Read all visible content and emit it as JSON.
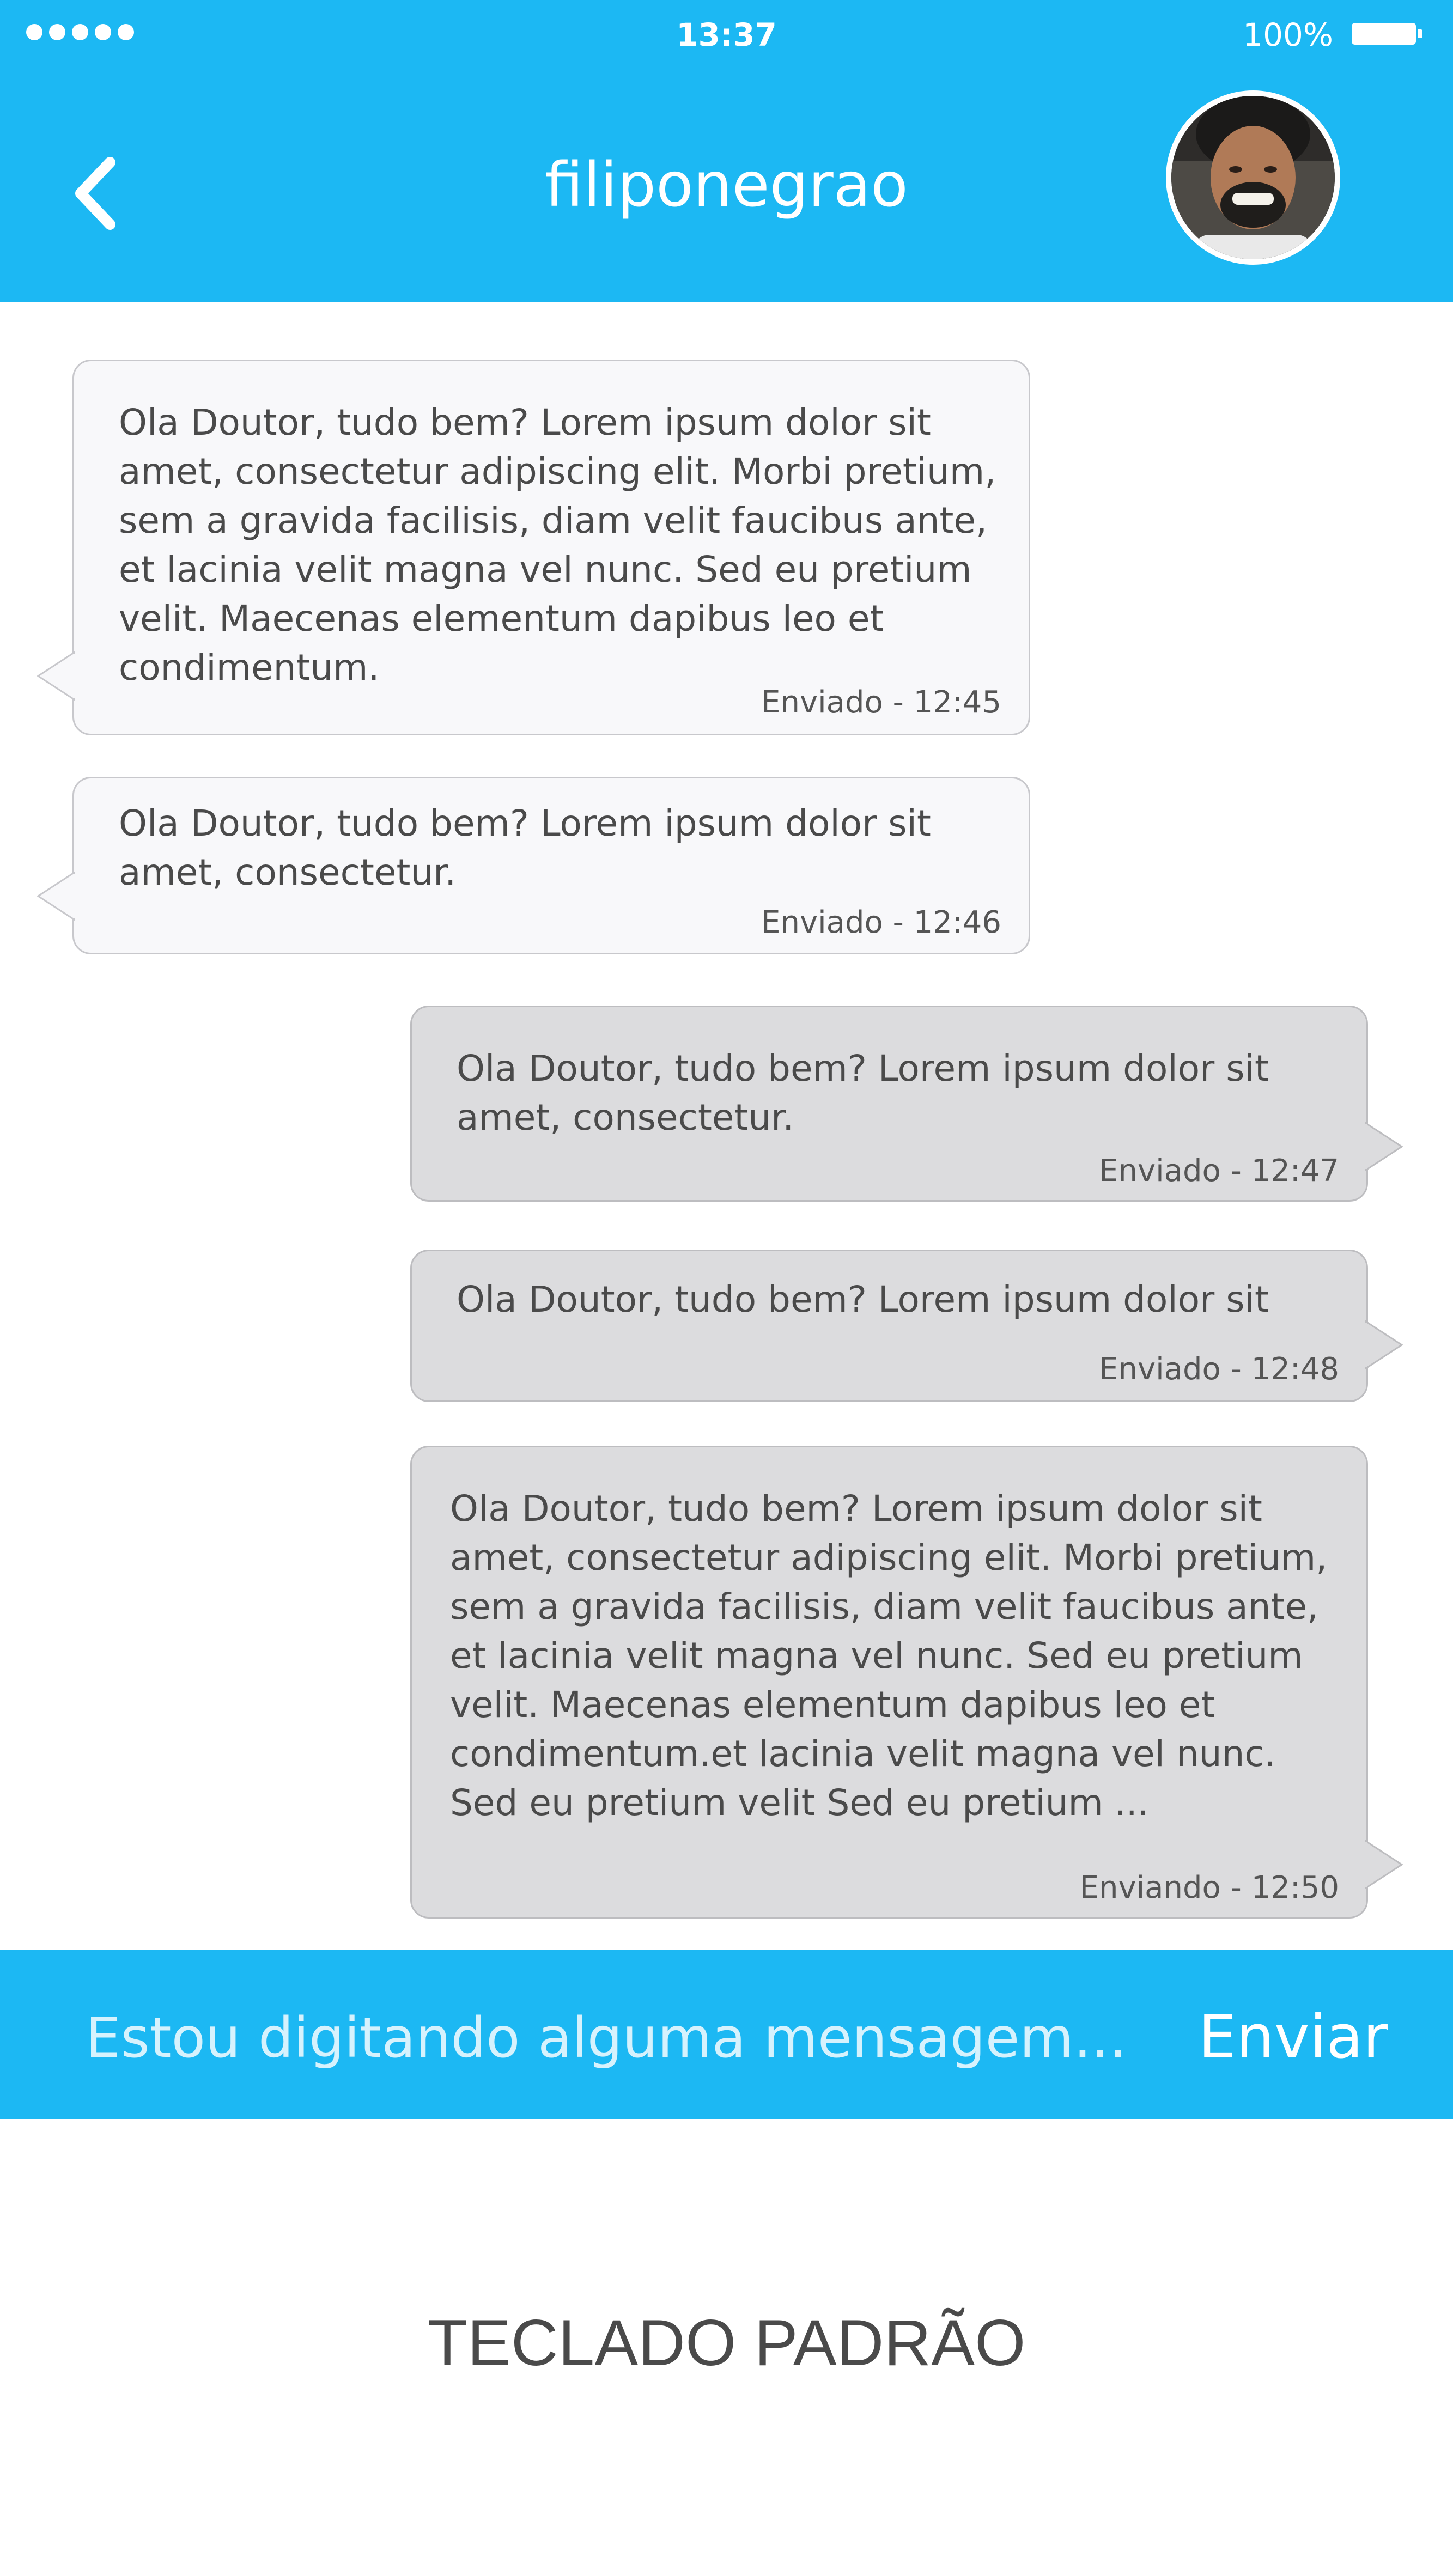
{
  "status_bar": {
    "time": "13:37",
    "battery": "100%"
  },
  "header": {
    "title": "filiponegrao"
  },
  "messages": [
    {
      "direction": "in",
      "text": "Ola Doutor, tudo bem? Lorem ipsum dolor sit\namet, consectetur adipiscing elit. Morbi pretium,\nsem a gravida facilisis, diam velit faucibus ante,\net lacinia velit magna vel nunc. Sed eu pretium\nvelit. Maecenas elementum dapibus leo et\ncondimentum.",
      "time": "Enviado - 12:45"
    },
    {
      "direction": "in",
      "text": "Ola Doutor, tudo bem? Lorem ipsum dolor sit\namet, consectetur.",
      "time": "Enviado - 12:46"
    },
    {
      "direction": "out",
      "text": "Ola Doutor, tudo bem? Lorem ipsum dolor sit\namet, consectetur.",
      "time": "Enviado - 12:47"
    },
    {
      "direction": "out",
      "text": "Ola Doutor, tudo bem? Lorem ipsum dolor sit",
      "time": "Enviado - 12:48"
    },
    {
      "direction": "out",
      "text": "Ola Doutor, tudo bem? Lorem ipsum dolor sit\namet, consectetur adipiscing elit. Morbi pretium,\nsem a gravida facilisis, diam velit faucibus ante,\net lacinia velit magna vel nunc. Sed eu pretium\nvelit. Maecenas elementum dapibus leo et\ncondimentum.et lacinia velit magna vel nunc.\nSed eu pretium velit Sed eu pretium ...",
      "time": "Enviando - 12:50"
    }
  ],
  "composer": {
    "placeholder": "Estou digitando alguma mensagem...",
    "send_label": "Enviar"
  },
  "keyboard": {
    "label": "TECLADO PADRÃO"
  },
  "colors": {
    "accent": "#1cb8f3",
    "incoming_bubble": "#f8f8fa",
    "outgoing_bubble": "#dcdcde"
  }
}
